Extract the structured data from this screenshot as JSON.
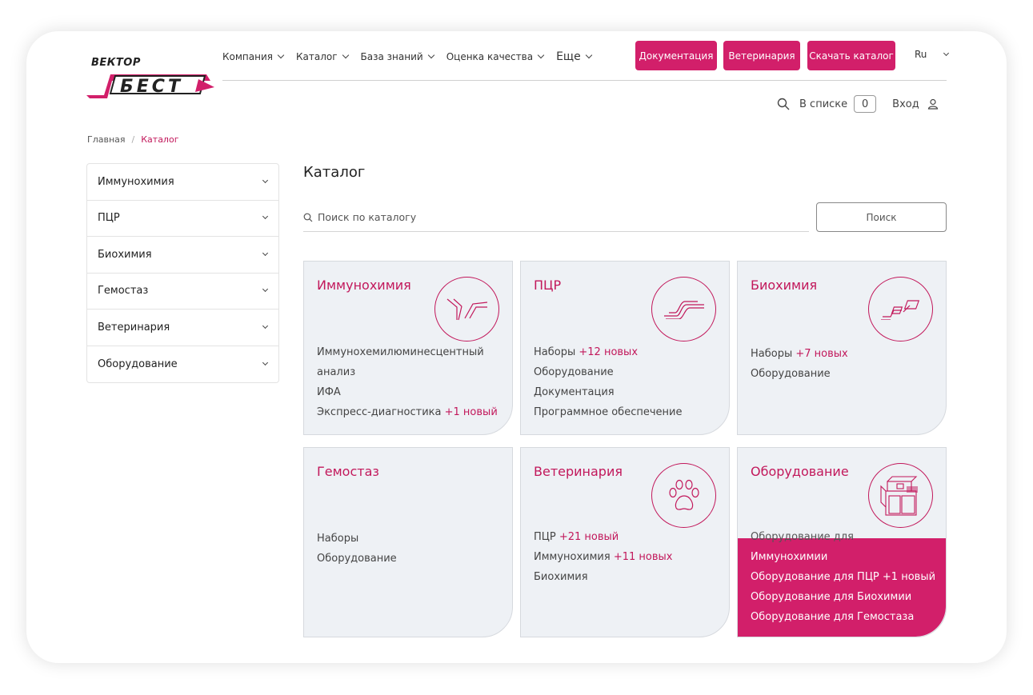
{
  "logo": {
    "top": "ВЕКТОР",
    "main": "БЕСТ"
  },
  "nav": {
    "items": [
      {
        "label": "Компания"
      },
      {
        "label": "Каталог"
      },
      {
        "label": "База знаний"
      },
      {
        "label": "Оценка качества"
      },
      {
        "label": "Еще"
      }
    ],
    "buttons": [
      "Документация",
      "Ветеринария",
      "Скачать каталог"
    ],
    "lang": "Ru"
  },
  "util": {
    "list_label": "В списке",
    "list_count": "0",
    "login": "Вход"
  },
  "breadcrumb": {
    "home": "Главная",
    "sep": "/",
    "current": "Каталог"
  },
  "sidebar": {
    "items": [
      "Иммунохимия",
      "ПЦР",
      "Биохимия",
      "Гемостаз",
      "Ветеринария",
      "Оборудование"
    ]
  },
  "main": {
    "title": "Каталог",
    "search_placeholder": "Поиск по каталогу",
    "search_button": "Поиск"
  },
  "cards": [
    {
      "title": "Иммунохимия",
      "icon": "antibody-icon",
      "links": [
        {
          "text": "Иммунохемилюминесцентный",
          "new": ""
        },
        {
          "text": "анализ",
          "new": ""
        },
        {
          "text": "ИФА",
          "new": ""
        },
        {
          "text": "Экспресс-диагностика",
          "new": "+1 новый"
        }
      ]
    },
    {
      "title": "ПЦР",
      "icon": "pcr-curve-icon",
      "links": [
        {
          "text": "Наборы",
          "new": "+12 новых"
        },
        {
          "text": "Оборудование",
          "new": ""
        },
        {
          "text": "Документация",
          "new": ""
        },
        {
          "text": "Программное обеспечение",
          "new": ""
        }
      ]
    },
    {
      "title": "Биохимия",
      "icon": "biochemistry-icon",
      "links": [
        {
          "text": "Наборы",
          "new": "+7 новых"
        },
        {
          "text": "Оборудование",
          "new": ""
        }
      ]
    },
    {
      "title": "Гемостаз",
      "icon": "",
      "links": [
        {
          "text": "Наборы",
          "new": ""
        },
        {
          "text": "Оборудование",
          "new": ""
        }
      ]
    },
    {
      "title": "Ветеринария",
      "icon": "paw-icon",
      "links": [
        {
          "text": "ПЦР",
          "new": "+21 новый"
        },
        {
          "text": "Иммунохимия",
          "new": "+11 новых"
        },
        {
          "text": "Биохимия",
          "new": ""
        }
      ]
    },
    {
      "title": "Оборудование",
      "icon": "analyzer-icon",
      "links": [
        {
          "text": "Оборудование для",
          "new": ""
        },
        {
          "text": "Иммунохимии",
          "new": ""
        },
        {
          "text": "Оборудование для ПЦР",
          "new": "+1 новый"
        },
        {
          "text": "Оборудование для Биохимии",
          "new": ""
        },
        {
          "text": "Оборудование для Гемостаза",
          "new": ""
        }
      ]
    }
  ],
  "colors": {
    "accent": "#d21f6a",
    "accent_text": "#c2185b",
    "card_bg": "#eef1f5"
  }
}
